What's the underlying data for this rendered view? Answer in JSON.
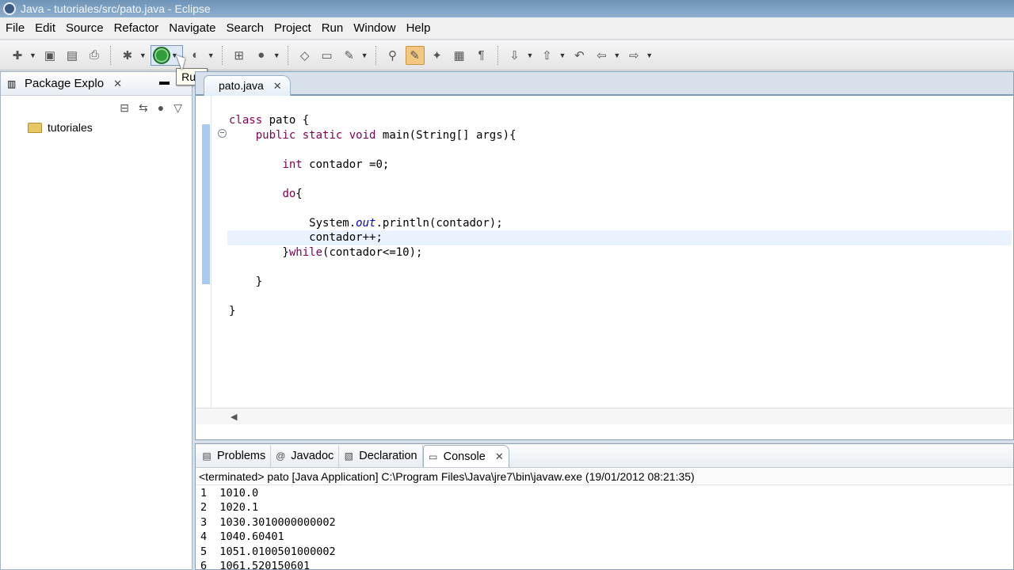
{
  "window": {
    "title": "Java - tutoriales/src/pato.java - Eclipse"
  },
  "menu": [
    "File",
    "Edit",
    "Source",
    "Refactor",
    "Navigate",
    "Search",
    "Project",
    "Run",
    "Window",
    "Help"
  ],
  "tooltip": {
    "text": "Run"
  },
  "package_explorer": {
    "tab_label": "Package Explo",
    "tree": [
      {
        "label": "tutoriales"
      }
    ]
  },
  "editor": {
    "tab_label": "pato.java",
    "code_lines": [
      "class pato {",
      "    public static void main(String[] args){",
      "",
      "        int contador =0;",
      "",
      "        do{",
      "",
      "            System.out.println(contador);",
      "            contador++;",
      "        }while(contador<=10);",
      "",
      "    }",
      "",
      "}"
    ]
  },
  "bottom_tabs": [
    {
      "label": "Problems",
      "icon": "problems-icon"
    },
    {
      "label": "Javadoc",
      "icon": "at-icon"
    },
    {
      "label": "Declaration",
      "icon": "declaration-icon"
    },
    {
      "label": "Console",
      "icon": "console-icon",
      "active": true
    }
  ],
  "console": {
    "status": "<terminated> pato [Java Application] C:\\Program Files\\Java\\jre7\\bin\\javaw.exe (19/01/2012 08:21:35)",
    "lines": [
      "1  1010.0",
      "2  1020.1",
      "3  1030.3010000000002",
      "4  1040.60401",
      "5  1051.0100501000002",
      "6  1061.520150601"
    ]
  }
}
